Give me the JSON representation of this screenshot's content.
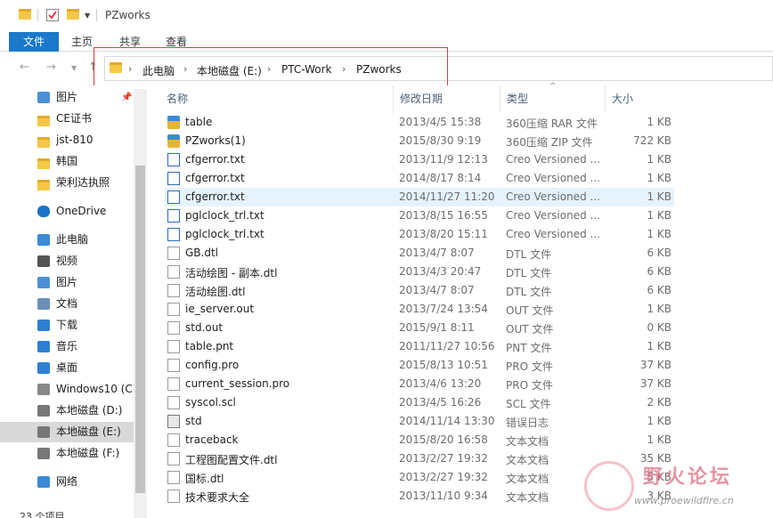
{
  "window": {
    "title": "PZworks"
  },
  "ribbon": {
    "tabs": [
      "文件",
      "主页",
      "共享",
      "查看"
    ]
  },
  "address": {
    "crumbs": [
      "此电脑",
      "本地磁盘 (E:)",
      "PTC-Work",
      "PZworks"
    ]
  },
  "nav": {
    "items": [
      {
        "label": "图片",
        "icon": "pictures-icon",
        "pinned": true
      },
      {
        "label": "CE证书",
        "icon": "folder-icon"
      },
      {
        "label": "jst-810",
        "icon": "folder-icon"
      },
      {
        "label": "韩国",
        "icon": "folder-icon"
      },
      {
        "label": "荣利达执照",
        "icon": "folder-icon"
      },
      {
        "label": "OneDrive",
        "icon": "onedrive-icon"
      },
      {
        "label": "此电脑",
        "icon": "computer-icon"
      },
      {
        "label": "视频",
        "icon": "videos-icon"
      },
      {
        "label": "图片",
        "icon": "pictures-icon"
      },
      {
        "label": "文档",
        "icon": "documents-icon"
      },
      {
        "label": "下载",
        "icon": "download-icon"
      },
      {
        "label": "音乐",
        "icon": "music-icon"
      },
      {
        "label": "桌面",
        "icon": "desktop-icon"
      },
      {
        "label": "Windows10 (C:",
        "icon": "windows-drive-icon"
      },
      {
        "label": "本地磁盘 (D:)",
        "icon": "drive-icon"
      },
      {
        "label": "本地磁盘 (E:)",
        "icon": "drive-icon",
        "selected": true
      },
      {
        "label": "本地磁盘 (F:)",
        "icon": "drive-icon"
      },
      {
        "label": "网络",
        "icon": "network-icon"
      }
    ]
  },
  "columns": {
    "name": "名称",
    "date": "修改日期",
    "type": "类型",
    "size": "大小"
  },
  "files": [
    {
      "name": "table",
      "date": "2013/4/5 15:38",
      "type": "360压缩 RAR 文件",
      "size": "1 KB",
      "icon": "rar"
    },
    {
      "name": "PZworks(1)",
      "date": "2015/8/30 9:19",
      "type": "360压缩 ZIP 文件",
      "size": "722 KB",
      "icon": "rar"
    },
    {
      "name": "cfgerror.txt",
      "date": "2013/11/9 12:13",
      "type": "Creo Versioned ...",
      "size": "1 KB",
      "icon": "txt"
    },
    {
      "name": "cfgerror.txt",
      "date": "2014/8/17 8:14",
      "type": "Creo Versioned ...",
      "size": "1 KB",
      "icon": "txt"
    },
    {
      "name": "cfgerror.txt",
      "date": "2014/11/27 11:20",
      "type": "Creo Versioned ...",
      "size": "1 KB",
      "icon": "txt",
      "selected": true
    },
    {
      "name": "pglclock_trl.txt",
      "date": "2013/8/15 16:55",
      "type": "Creo Versioned ...",
      "size": "1 KB",
      "icon": "txt"
    },
    {
      "name": "pglclock_trl.txt",
      "date": "2013/8/20 15:11",
      "type": "Creo Versioned ...",
      "size": "1 KB",
      "icon": "txt"
    },
    {
      "name": "GB.dtl",
      "date": "2013/4/7 8:07",
      "type": "DTL 文件",
      "size": "6 KB",
      "icon": "doc"
    },
    {
      "name": "活动绘图 - 副本.dtl",
      "date": "2013/4/3 20:47",
      "type": "DTL 文件",
      "size": "6 KB",
      "icon": "doc"
    },
    {
      "name": "活动绘图.dtl",
      "date": "2013/4/7 8:07",
      "type": "DTL 文件",
      "size": "6 KB",
      "icon": "doc"
    },
    {
      "name": "ie_server.out",
      "date": "2013/7/24 13:54",
      "type": "OUT 文件",
      "size": "1 KB",
      "icon": "doc"
    },
    {
      "name": "std.out",
      "date": "2015/9/1 8:11",
      "type": "OUT 文件",
      "size": "0 KB",
      "icon": "doc"
    },
    {
      "name": "table.pnt",
      "date": "2011/11/27 10:56",
      "type": "PNT 文件",
      "size": "1 KB",
      "icon": "doc"
    },
    {
      "name": "config.pro",
      "date": "2015/8/13 10:51",
      "type": "PRO 文件",
      "size": "37 KB",
      "icon": "doc"
    },
    {
      "name": "current_session.pro",
      "date": "2013/4/6 13:20",
      "type": "PRO 文件",
      "size": "37 KB",
      "icon": "doc"
    },
    {
      "name": "syscol.scl",
      "date": "2013/4/5 16:26",
      "type": "SCL 文件",
      "size": "2 KB",
      "icon": "doc"
    },
    {
      "name": "std",
      "date": "2014/11/14 13:30",
      "type": "错误日志",
      "size": "1 KB",
      "icon": "sys"
    },
    {
      "name": "traceback",
      "date": "2015/8/20 16:58",
      "type": "文本文档",
      "size": "1 KB",
      "icon": "doc"
    },
    {
      "name": "工程图配置文件.dtl",
      "date": "2013/2/27 19:32",
      "type": "文本文档",
      "size": "35 KB",
      "icon": "doc"
    },
    {
      "name": "国标.dtl",
      "date": "2013/2/27 19:32",
      "type": "文本文档",
      "size": "5 KB",
      "icon": "doc"
    },
    {
      "name": "技术要求大全",
      "date": "2013/11/10 9:34",
      "type": "文本文档",
      "size": "3 KB",
      "icon": "doc"
    }
  ],
  "status": {
    "count_text": "23 个项目"
  },
  "watermark": {
    "text": "野火论坛",
    "url": "www.proewildfire.cn"
  }
}
